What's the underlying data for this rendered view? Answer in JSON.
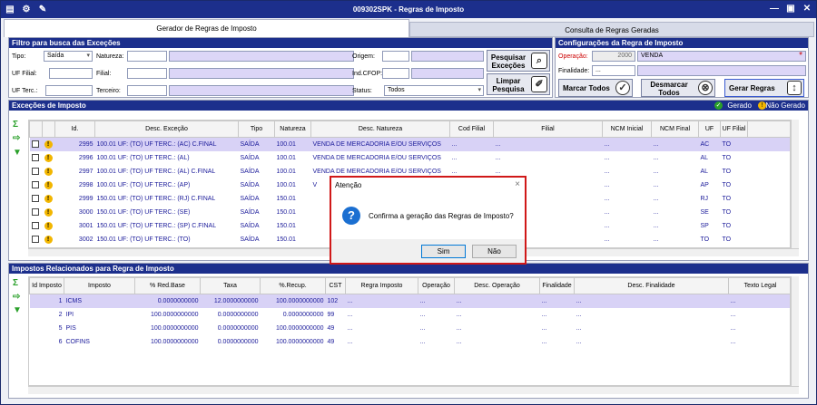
{
  "window": {
    "title": "009302SPK - Regras de Imposto"
  },
  "tabs": [
    {
      "label": "Gerador de Regras de Imposto"
    },
    {
      "label": "Consulta de Regras Geradas"
    }
  ],
  "filter": {
    "header": "Filtro para busca das Exceções",
    "tipo_label": "Tipo:",
    "tipo_value": "Saída",
    "natureza_label": "Natureza:",
    "uf_filial_label": "UF Filial:",
    "filial_label": "Filial:",
    "uf_terc_label": "UF Terc.:",
    "terceiro_label": "Terceiro:",
    "origem_label": "Origem:",
    "ind_cfop_label": "Ind.CFOP:",
    "status_label": "Status:",
    "status_value": "Todos",
    "pesquisar_label": "Pesquisar Exceções",
    "limpar_label": "Limpar Pesquisa"
  },
  "config": {
    "header": "Configurações da Regra de Imposto",
    "operacao_label": "Operação:",
    "operacao_code": "2000",
    "operacao_desc": "VENDA",
    "finalidade_label": "Finalidade:",
    "finalidade_value": "...",
    "marcar_label": "Marcar Todos",
    "desmarcar_label": "Desmarcar Todos",
    "gerar_label": "Gerar Regras",
    "required_mark": "*"
  },
  "excecoes": {
    "header": "Exceções de Imposto",
    "legend_gerado": "Gerado",
    "legend_nao_gerado": "Não Gerado",
    "columns": [
      "Id.",
      "Desc. Exceção",
      "Tipo",
      "Natureza",
      "Desc. Natureza",
      "Cod Filial",
      "Filial",
      "NCM Inicial",
      "NCM Final",
      "UF",
      "UF Filial"
    ],
    "rows": [
      {
        "id": "2995",
        "desc": "100.01 UF: (TO) UF TERC.: (AC) C.FINAL",
        "tipo": "SAÍDA",
        "nat": "100.01",
        "descnat": "VENDA DE MERCADORIA E/OU SERVIÇOS",
        "codfilial": "...",
        "filial": "...",
        "ncmi": "...",
        "ncmf": "...",
        "uf": "AC",
        "uffilial": "TO"
      },
      {
        "id": "2996",
        "desc": "100.01 UF: (TO) UF TERC.: (AL)",
        "tipo": "SAÍDA",
        "nat": "100.01",
        "descnat": "VENDA DE MERCADORIA E/OU SERVIÇOS",
        "codfilial": "...",
        "filial": "...",
        "ncmi": "...",
        "ncmf": "...",
        "uf": "AL",
        "uffilial": "TO"
      },
      {
        "id": "2997",
        "desc": "100.01 UF: (TO) UF TERC.: (AL) C.FINAL",
        "tipo": "SAÍDA",
        "nat": "100.01",
        "descnat": "VENDA DE MERCADORIA E/OU SERVIÇOS",
        "codfilial": "...",
        "filial": "...",
        "ncmi": "...",
        "ncmf": "...",
        "uf": "AL",
        "uffilial": "TO"
      },
      {
        "id": "2998",
        "desc": "100.01 UF: (TO) UF TERC.: (AP)",
        "tipo": "SAÍDA",
        "nat": "100.01",
        "descnat": "V",
        "codfilial": "",
        "filial": "",
        "ncmi": "...",
        "ncmf": "...",
        "uf": "AP",
        "uffilial": "TO"
      },
      {
        "id": "2999",
        "desc": "150.01 UF: (TO) UF TERC.: (RJ) C.FINAL",
        "tipo": "SAÍDA",
        "nat": "150.01",
        "descnat": "",
        "codfilial": "",
        "filial": "",
        "ncmi": "...",
        "ncmf": "...",
        "uf": "RJ",
        "uffilial": "TO"
      },
      {
        "id": "3000",
        "desc": "150.01 UF: (TO) UF TERC.: (SE)",
        "tipo": "SAÍDA",
        "nat": "150.01",
        "descnat": "",
        "codfilial": "",
        "filial": "",
        "ncmi": "...",
        "ncmf": "...",
        "uf": "SE",
        "uffilial": "TO"
      },
      {
        "id": "3001",
        "desc": "150.01 UF: (TO) UF TERC.: (SP) C.FINAL",
        "tipo": "SAÍDA",
        "nat": "150.01",
        "descnat": "",
        "codfilial": "",
        "filial": "",
        "ncmi": "...",
        "ncmf": "...",
        "uf": "SP",
        "uffilial": "TO"
      },
      {
        "id": "3002",
        "desc": "150.01 UF: (TO) UF TERC.: (TO)",
        "tipo": "SAÍDA",
        "nat": "150.01",
        "descnat": "",
        "codfilial": "",
        "filial": "",
        "ncmi": "...",
        "ncmf": "...",
        "uf": "TO",
        "uffilial": "TO"
      }
    ]
  },
  "impostos": {
    "header": "Impostos Relacionados para Regra de Imposto",
    "columns": [
      "Id Imposto",
      "Imposto",
      "% Red.Base",
      "Taxa",
      "%.Recup.",
      "CST",
      "Regra Imposto",
      "Operação",
      "Desc. Operação",
      "Finalidade",
      "Desc. Finalidade",
      "Texto Legal"
    ],
    "rows": [
      {
        "id": "1",
        "imposto": "ICMS",
        "red": "0.0000000000",
        "taxa": "12.0000000000",
        "recup": "100.0000000000",
        "cst": "102",
        "regra": "...",
        "op": "...",
        "descop": "...",
        "fin": "...",
        "descfin": "...",
        "texto": "..."
      },
      {
        "id": "2",
        "imposto": "IPI",
        "red": "100.0000000000",
        "taxa": "0.0000000000",
        "recup": "0.0000000000",
        "cst": "99",
        "regra": "...",
        "op": "...",
        "descop": "...",
        "fin": "...",
        "descfin": "...",
        "texto": "..."
      },
      {
        "id": "5",
        "imposto": "PIS",
        "red": "100.0000000000",
        "taxa": "0.0000000000",
        "recup": "100.0000000000",
        "cst": "49",
        "regra": "...",
        "op": "...",
        "descop": "...",
        "fin": "...",
        "descfin": "...",
        "texto": "..."
      },
      {
        "id": "6",
        "imposto": "COFINS",
        "red": "100.0000000000",
        "taxa": "0.0000000000",
        "recup": "100.0000000000",
        "cst": "49",
        "regra": "...",
        "op": "...",
        "descop": "...",
        "fin": "...",
        "descfin": "...",
        "texto": "..."
      }
    ]
  },
  "dialog": {
    "title": "Atenção",
    "close": "×",
    "icon": "?",
    "message": "Confirma a geração das Regras de Imposto?",
    "yes": "Sim",
    "no": "Não"
  },
  "colors": {
    "titlebar": "#1c2f8c",
    "selected_row": "#d8d2f6",
    "dialog_border": "#d01818"
  }
}
